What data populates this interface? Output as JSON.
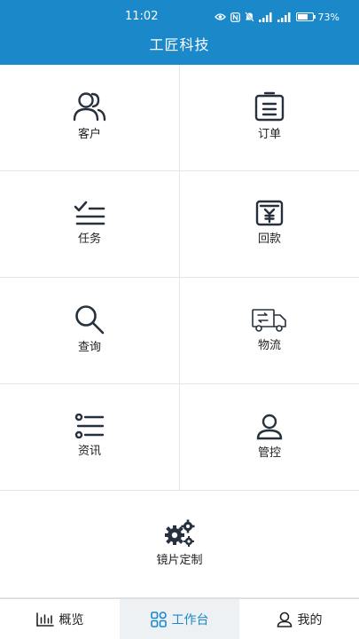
{
  "status_bar": {
    "time": "11:02",
    "battery_percent": "73%",
    "battery_level": 0.73
  },
  "header": {
    "title": "工匠科技"
  },
  "menu": {
    "customer": "客户",
    "order": "订单",
    "task": "任务",
    "payment": "回款",
    "query": "查询",
    "logistics": "物流",
    "news": "资讯",
    "control": "管控",
    "lens_custom": "镜片定制"
  },
  "tabbar": {
    "overview": "概览",
    "workbench": "工作台",
    "mine": "我的",
    "active_tab": "workbench",
    "active_color": "#1a88c9"
  },
  "colors": {
    "header_bg": "#1a88c9",
    "icon_stroke": "#26313d"
  }
}
